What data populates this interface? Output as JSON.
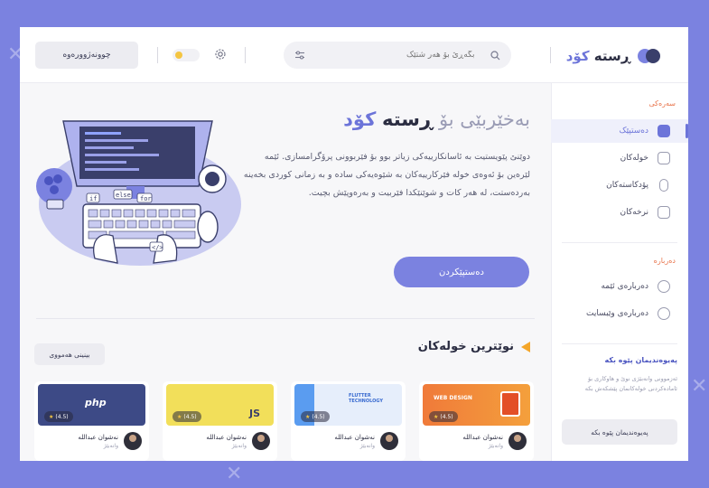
{
  "header": {
    "logo_text_main": "ڕستە",
    "logo_text_accent": "کۆد",
    "search_placeholder": "بگەڕێ بۆ هەر شتێک",
    "login_label": "چوونەژوورەوە"
  },
  "sidebar": {
    "section_title": "سەرەکی",
    "items": [
      {
        "label": "دەستپێک",
        "icon": "home-icon"
      },
      {
        "label": "خولەکان",
        "icon": "book-icon"
      },
      {
        "label": "پۆدکاستەکان",
        "icon": "microphone-icon"
      },
      {
        "label": "نرخەکان",
        "icon": "lock-icon"
      }
    ],
    "about_title": "دەربارە",
    "about_items": [
      {
        "label": "دەربارەی ئێمە",
        "icon": "user-icon"
      },
      {
        "label": "دەربارەی وێبسایت",
        "icon": "globe-icon"
      }
    ],
    "contact_title": "پەیوەندیمان پێوە بکە",
    "contact_text": "ئەزموونی وانەبێژی نوێ و هاوکاری بۆ ئامادەکردنی خولەکانمان پێشکەش بکە",
    "contact_button": "پەیوەندیمان پێوە بکە"
  },
  "hero": {
    "title_prefix": "بەخێربێی بۆ",
    "title_main": "ڕستە",
    "title_accent": "کۆد",
    "body": "دوێنێ پێویستیت بە ئاسانکارییەکی زیاتر بوو بۆ فێربوونی پرۆگرامسازی. ئێمە لێرەین بۆ ئەوەی خولە فێرکارییەکان بە شێوەیەکی سادە و بە زمانی کوردی بخەینە بەردەستت، لە هەر کات و شوێنێکدا فێربیت و بەرەوپێش بچیت.",
    "start_button": "دەستپێکردن"
  },
  "courses": {
    "title": "نوێترین خولەکان",
    "see_all": "بینینی هەمووی",
    "items": [
      {
        "thumb": "php",
        "thumb_text": "php",
        "rating": "(4.5)",
        "author": "نەشوان عبداللە",
        "role": "وانەبێژ"
      },
      {
        "thumb": "js",
        "thumb_text": "JS",
        "rating": "(4.5)",
        "author": "نەشوان عبداللە",
        "role": "وانەبێژ"
      },
      {
        "thumb": "flutter",
        "thumb_text": "FLUTTER TECHNOLOGY",
        "rating": "(4.5)",
        "author": "نەشوان عبداللە",
        "role": "وانەبێژ"
      },
      {
        "thumb": "html",
        "thumb_text": "WEB DESIGN",
        "rating": "(4.5)",
        "author": "نەشوان عبداللە",
        "role": "وانەبێژ"
      }
    ]
  },
  "colors": {
    "background": "#7b82e0",
    "accent": "#6c74d9",
    "orange": "#f4a62a",
    "dark": "#2b2d42"
  }
}
